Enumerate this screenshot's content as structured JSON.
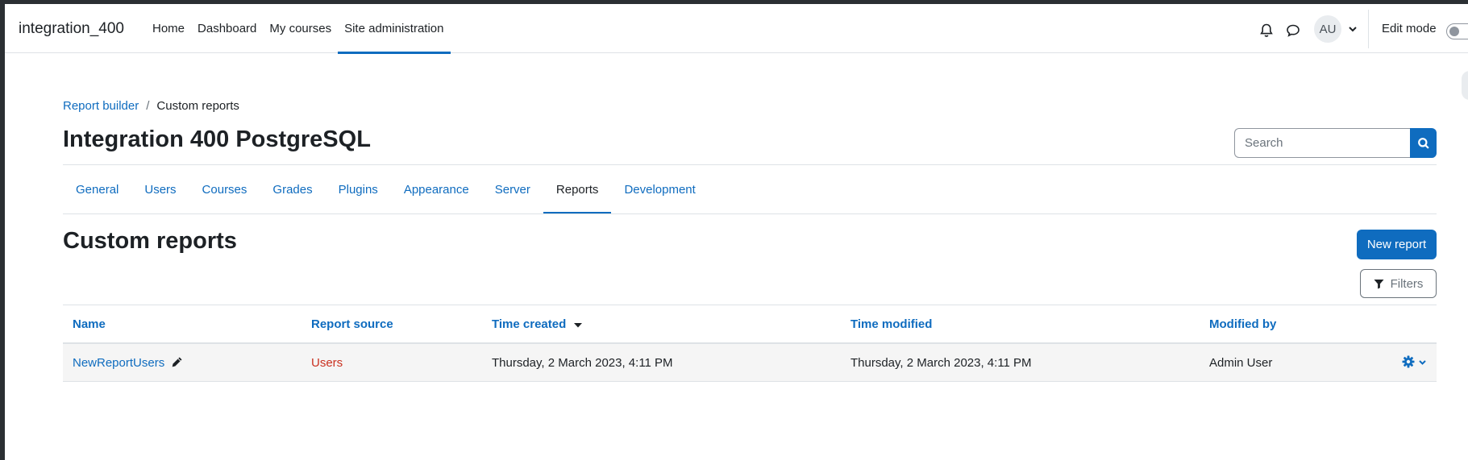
{
  "navbar": {
    "brand": "integration_400",
    "items": [
      {
        "label": "Home",
        "active": false
      },
      {
        "label": "Dashboard",
        "active": false
      },
      {
        "label": "My courses",
        "active": false
      },
      {
        "label": "Site administration",
        "active": true
      }
    ],
    "user_initials": "AU",
    "edit_mode_label": "Edit mode",
    "edit_mode_on": false,
    "icons": [
      "bell-icon",
      "message-icon",
      "chevron-down-icon"
    ]
  },
  "header": {
    "breadcrumb": [
      {
        "label": "Report builder",
        "link": true
      },
      {
        "label": "Custom reports",
        "link": false
      }
    ],
    "title": "Integration 400 PostgreSQL",
    "search": {
      "placeholder": "Search"
    }
  },
  "secondary_nav": {
    "tabs": [
      {
        "label": "General",
        "active": false
      },
      {
        "label": "Users",
        "active": false
      },
      {
        "label": "Courses",
        "active": false
      },
      {
        "label": "Grades",
        "active": false
      },
      {
        "label": "Plugins",
        "active": false
      },
      {
        "label": "Appearance",
        "active": false
      },
      {
        "label": "Server",
        "active": false
      },
      {
        "label": "Reports",
        "active": true
      },
      {
        "label": "Development",
        "active": false
      }
    ]
  },
  "main": {
    "title": "Custom reports",
    "new_report_label": "New report",
    "filters_label": "Filters",
    "table": {
      "columns": [
        "Name",
        "Report source",
        "Time created",
        "Time modified",
        "Modified by"
      ],
      "sorted_column": "Time created",
      "sort_direction": "desc",
      "rows": [
        {
          "name": "NewReportUsers",
          "source": "Users",
          "time_created": "Thursday, 2 March 2023, 4:11 PM",
          "time_modified": "Thursday, 2 March 2023, 4:11 PM",
          "modified_by": "Admin User"
        }
      ]
    }
  },
  "colors": {
    "primary": "#0f6cbf",
    "text": "#1d2125",
    "source_text": "#ca3120",
    "row_background": "#f5f5f5",
    "border": "#dee2e6"
  }
}
